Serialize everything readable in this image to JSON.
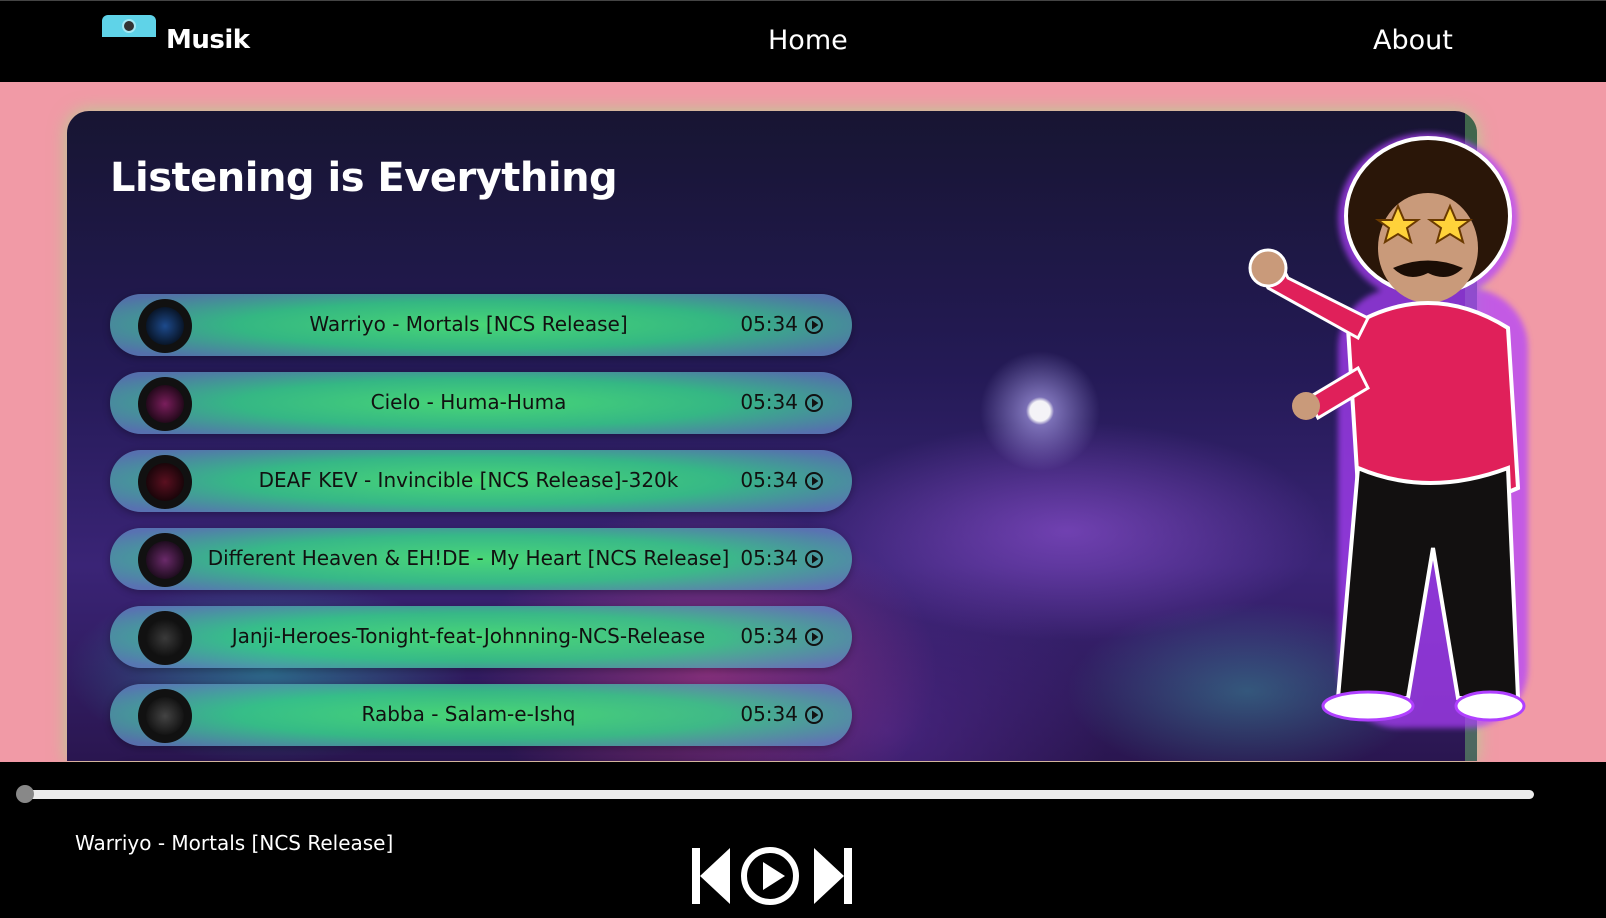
{
  "nav": {
    "brand": "Musik",
    "links": [
      "Home",
      "About"
    ]
  },
  "main": {
    "title": "Listening is Everything"
  },
  "songs": [
    {
      "name": "Warriyo - Mortals [NCS Release]",
      "duration": "05:34",
      "cover_color": "#1d4a8c"
    },
    {
      "name": "Cielo - Huma-Huma",
      "duration": "05:34",
      "cover_color": "#7a1e5c"
    },
    {
      "name": "DEAF KEV - Invincible [NCS Release]-320k",
      "duration": "05:34",
      "cover_color": "#5a1020"
    },
    {
      "name": "Different Heaven & EH!DE - My Heart [NCS Release]",
      "duration": "05:34",
      "cover_color": "#6a2a6a"
    },
    {
      "name": "Janji-Heroes-Tonight-feat-Johnning-NCS-Release",
      "duration": "05:34",
      "cover_color": "#3a3a3a"
    },
    {
      "name": "Rabba - Salam-e-Ishq",
      "duration": "05:34",
      "cover_color": "#444444"
    }
  ],
  "player": {
    "now_playing": "Warriyo - Mortals [NCS Release]",
    "progress": 0
  },
  "icons": {
    "prev": "skip-back-icon",
    "play": "play-circle-icon",
    "next": "skip-forward-icon",
    "song_play": "play-circle-icon"
  }
}
